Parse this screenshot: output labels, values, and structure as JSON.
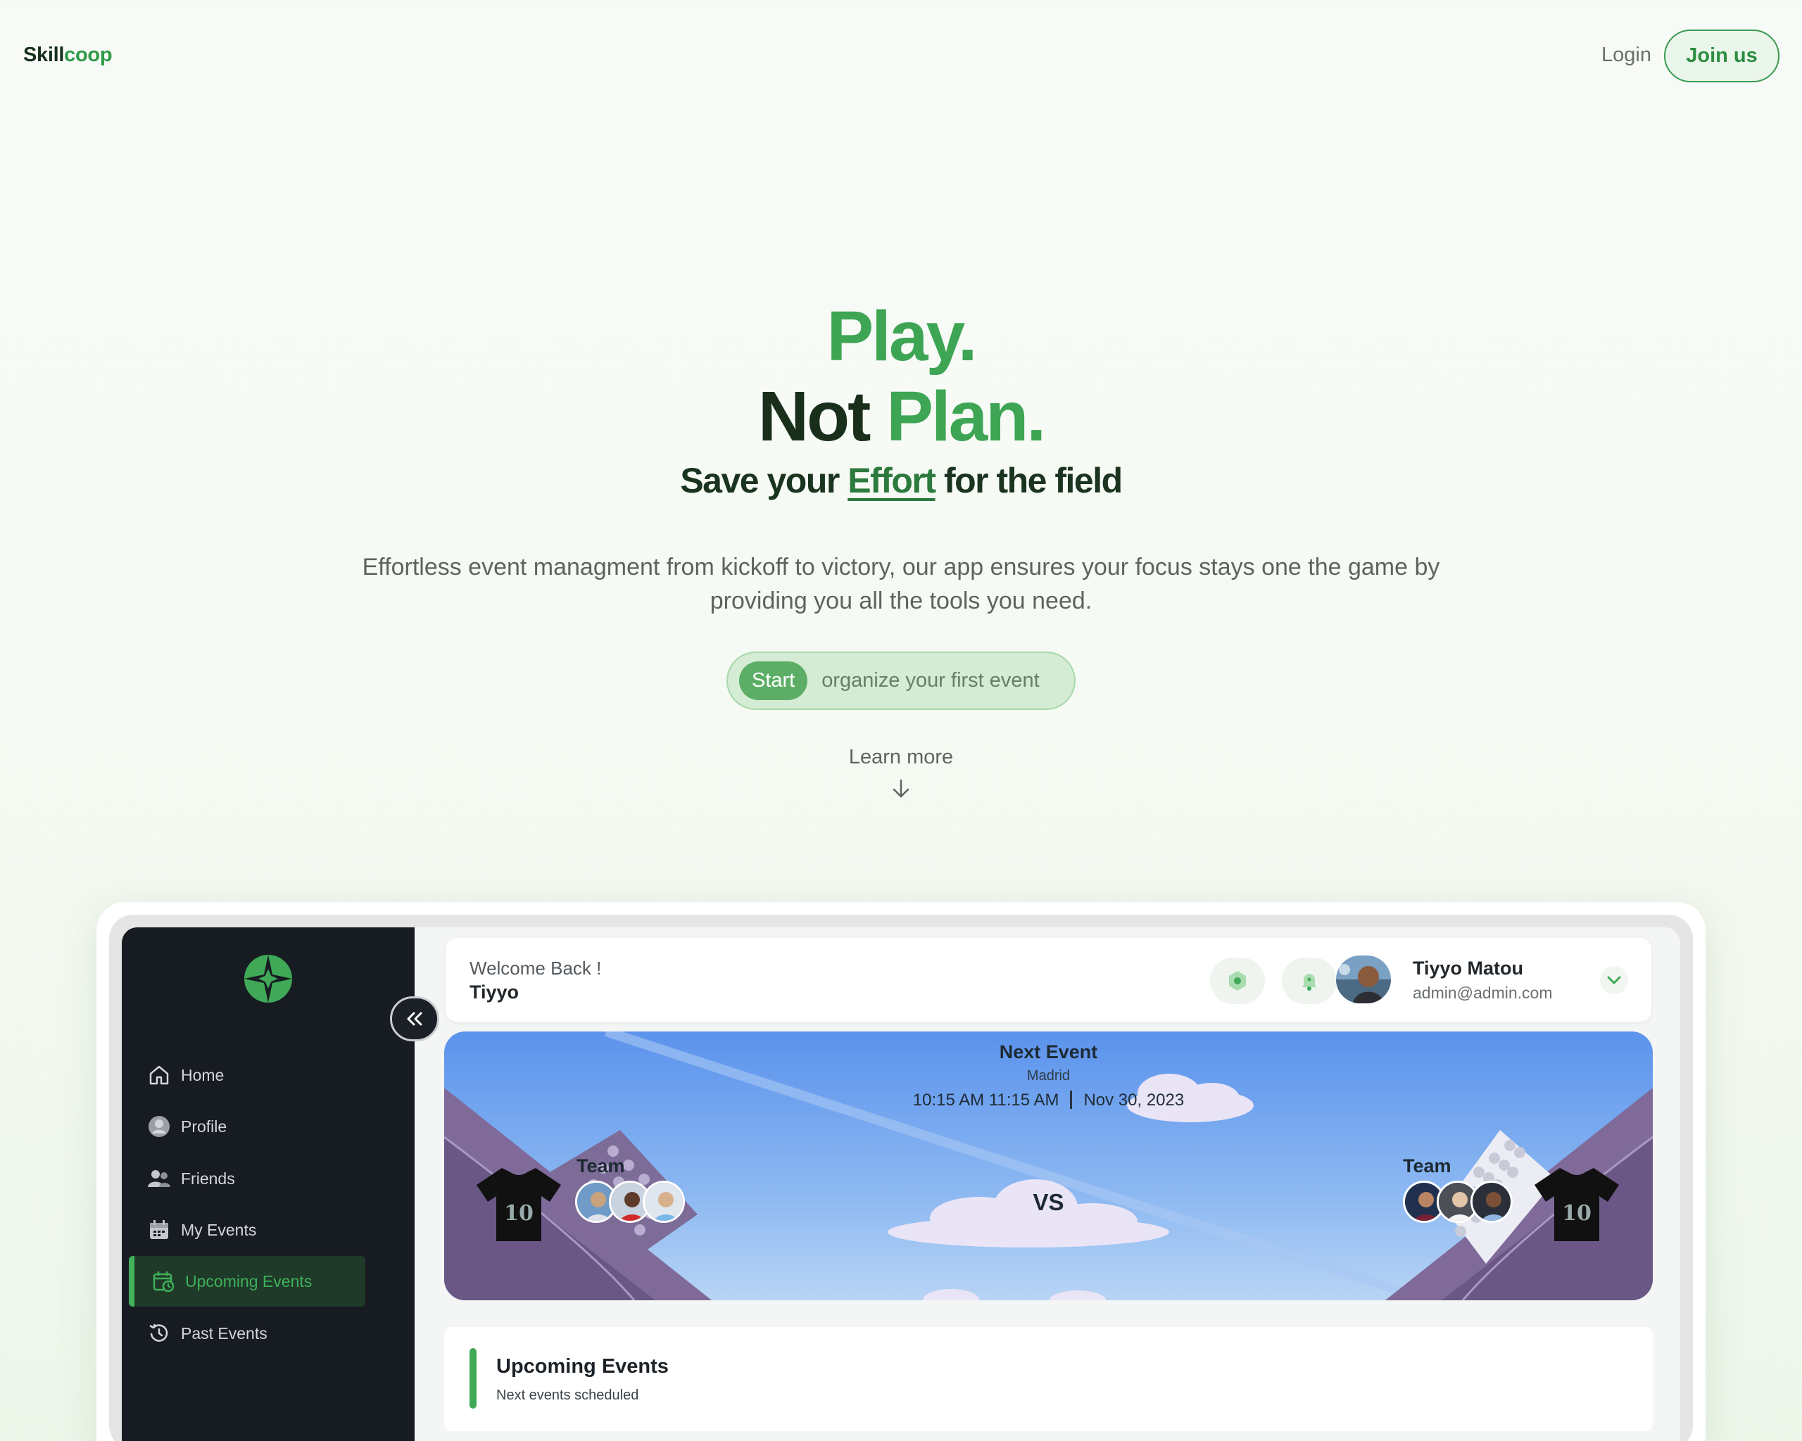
{
  "nav": {
    "brand_part1": "Skill",
    "brand_part2": "coop",
    "login_label": "Login",
    "join_label": "Join us"
  },
  "hero": {
    "line1": "Play.",
    "line2_dark": "Not ",
    "line2_green": "Plan.",
    "subhead_pre": "Save your ",
    "subhead_em": "Effort",
    "subhead_post": " for the field",
    "description": "Effortless event managment from kickoff to victory, our app ensures your focus stays one the game by providing you all the tools you need.",
    "cta_start": "Start",
    "cta_rest": "organize your first event",
    "learn_more": "Learn more"
  },
  "app": {
    "sidebar": {
      "items": [
        {
          "label": "Home",
          "icon": "home-icon"
        },
        {
          "label": "Profile",
          "icon": "profile-icon"
        },
        {
          "label": "Friends",
          "icon": "friends-icon"
        },
        {
          "label": "My Events",
          "icon": "calendar-icon"
        },
        {
          "label": "Upcoming Events",
          "icon": "calendar-clock-icon",
          "active": true
        },
        {
          "label": "Past Events",
          "icon": "history-icon"
        }
      ]
    },
    "header": {
      "welcome": "Welcome Back !",
      "short_name": "Tiyyo",
      "user_name": "Tiyyo Matou",
      "user_email": "admin@admin.com"
    },
    "banner": {
      "title": "Next Event",
      "location": "Madrid",
      "time_range": "10:15 AM 11:15 AM",
      "date": "Nov 30, 2023",
      "vs": "VS",
      "team_left": "Team",
      "team_right": "Team",
      "jersey_number_left": "10",
      "jersey_number_right": "10"
    },
    "upcoming": {
      "title": "Upcoming Events",
      "subtitle": "Next events scheduled"
    }
  },
  "colors": {
    "brand_green": "#3da553",
    "dark_green": "#1a2e1c",
    "sidebar_bg": "#171b22",
    "active_green": "#3fb05a"
  }
}
